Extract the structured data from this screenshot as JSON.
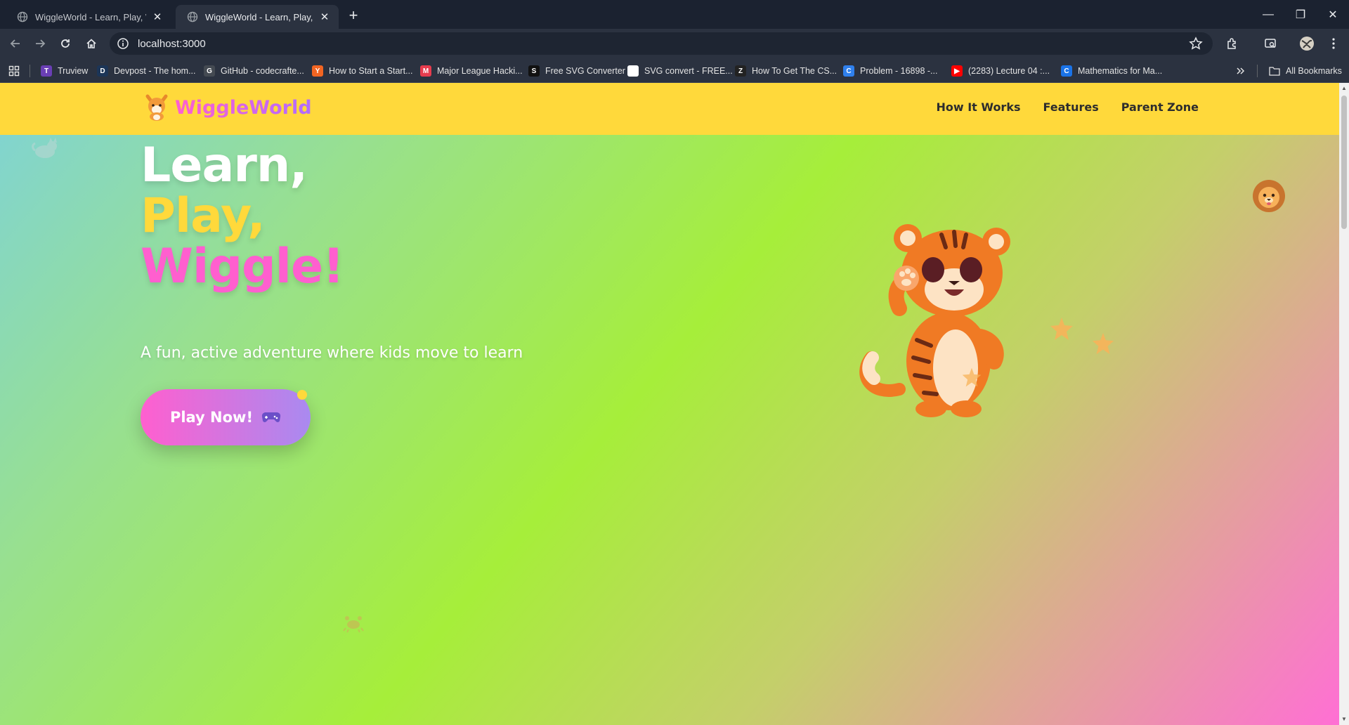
{
  "browser": {
    "tabs": [
      {
        "title": "WiggleWorld - Learn, Play, Wiggle!",
        "active": false
      },
      {
        "title": "WiggleWorld - Learn, Play, Wiggle!",
        "active": true
      }
    ],
    "url": "localhost:3000",
    "bookmarks": [
      {
        "label": "Truview",
        "color": "#6a3fb5",
        "glyph": "T"
      },
      {
        "label": "Devpost - The hom...",
        "color": "#1c3557",
        "glyph": "D"
      },
      {
        "label": "GitHub - codecrafte...",
        "color": "#444a52",
        "glyph": "G"
      },
      {
        "label": "How to Start a Start...",
        "color": "#f26522",
        "glyph": "Y"
      },
      {
        "label": "Major League Hacki...",
        "color": "#e73c4e",
        "glyph": "M"
      },
      {
        "label": "Free SVG Converter",
        "color": "#111111",
        "glyph": "S"
      },
      {
        "label": "SVG convert - FREE...",
        "color": "#ffffff",
        "glyph": ""
      },
      {
        "label": "How To Get The CS...",
        "color": "#222222",
        "glyph": "Z"
      },
      {
        "label": "Problem - 16898 -...",
        "color": "#2f80ed",
        "glyph": "C"
      },
      {
        "label": "(2283) Lecture 04 :...",
        "color": "#ff0000",
        "glyph": "▶"
      },
      {
        "label": "Mathematics for Ma...",
        "color": "#1a73e8",
        "glyph": "C"
      }
    ],
    "all_bookmarks_label": "All Bookmarks"
  },
  "page": {
    "brand": "WiggleWorld",
    "nav": [
      "How It Works",
      "Features",
      "Parent Zone"
    ],
    "hero": {
      "line1": "Learn,",
      "line2": "Play,",
      "line3": "Wiggle!",
      "line1_color": "#ffffff",
      "line2_color": "#ffd93b",
      "line3_color": "#ff5fcf",
      "subtitle": "A fun, active adventure where kids move to learn",
      "cta": "Play Now!",
      "cta_icon": "gamepad-icon"
    },
    "colors": {
      "navbar": "#ffd93b",
      "accent_pink": "#ff5fcf",
      "accent_purple": "#b06cff"
    }
  }
}
